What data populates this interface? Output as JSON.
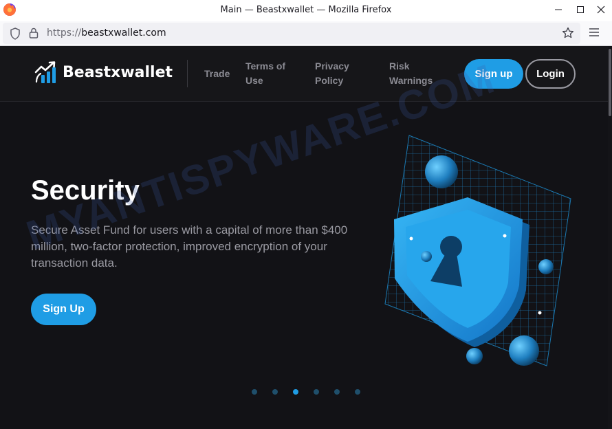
{
  "window": {
    "title": "Main — Beastxwallet — Mozilla Firefox"
  },
  "browser": {
    "url_scheme": "https://",
    "url_host": "beastxwallet.com"
  },
  "site": {
    "brand": "Beastxwallet",
    "nav": {
      "trade": "Trade",
      "terms": "Terms of Use",
      "privacy": "Privacy Policy",
      "risk": "Risk Warnings"
    },
    "signup_label": "Sign up",
    "login_label": "Login"
  },
  "hero": {
    "title": "Security",
    "text": "Secure Asset Fund for users with a capital of more than $400 million, two-factor protection, improved encryption of your transaction data.",
    "cta_label": "Sign Up",
    "slide_count": 6,
    "active_slide": 3
  },
  "watermark": "MYANTISPYWARE.COM",
  "colors": {
    "accent": "#1f9de5",
    "page_bg": "#121216",
    "header_bg": "#161619"
  }
}
